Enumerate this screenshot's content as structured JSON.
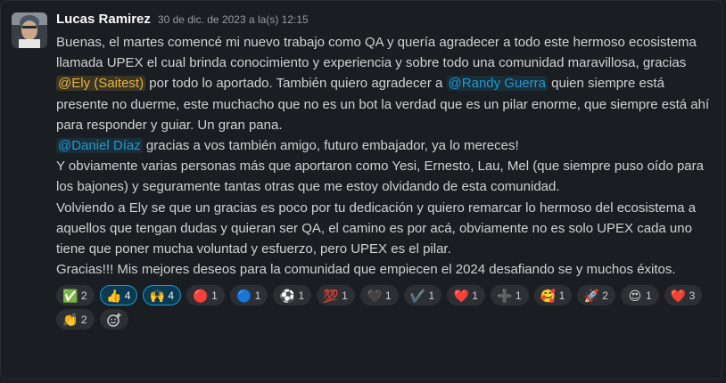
{
  "message": {
    "author": "Lucas Ramirez",
    "timestamp": "30 de dic. de 2023 a la(s) 12:15",
    "paragraphs": {
      "p1_a": "Buenas, el martes comencé mi nuevo trabajo como QA y quería agradecer a todo este hermoso ecosistema llamada UPEX el cual brinda conocimiento y experiencia y sobre todo una comunidad maravillosa, gracias ",
      "p1_mention1": "@Ely (Saitest)",
      "p1_b": " por todo lo aportado. También quiero agradecer a ",
      "p1_mention2": "@Randy Guerra",
      "p1_c": " quien siempre está presente no duerme, este muchacho que no es un bot la verdad que es un pilar enorme, que siempre está ahí para responder y guiar. Un gran pana.",
      "p2_mention": "@Daniel Díaz",
      "p2_text": " gracias a vos también amigo, futuro embajador, ya lo mereces!",
      "p3": "Y obviamente varias personas más que aportaron como Yesi, Ernesto, Lau, Mel (que siempre puso oído para los bajones) y seguramente tantas otras que me estoy olvidando de esta comunidad.",
      "p4": "Volviendo a Ely se que un gracias es poco por tu dedicación y quiero remarcar lo hermoso del ecosistema a aquellos que tengan dudas y quieran ser QA, el camino es por acá, obviamente no es solo UPEX cada uno tiene que poner mucha voluntad y esfuerzo, pero UPEX es el pilar.",
      "p5": "Gracias!!! Mis mejores deseos para la comunidad que empiecen el 2024 desafiando se y muchos éxitos."
    }
  },
  "reactions": [
    {
      "emoji": "✅",
      "icon": "white-check-mark-icon",
      "count": "2",
      "active": false
    },
    {
      "emoji": "👍",
      "icon": "thumbs-up-icon",
      "count": "4",
      "active": true
    },
    {
      "emoji": "🙌",
      "icon": "raised-hands-icon",
      "count": "4",
      "active": true
    },
    {
      "emoji": "🔴",
      "icon": "red-circle-icon",
      "count": "1",
      "active": false
    },
    {
      "emoji": "🔵",
      "icon": "blue-circle-icon",
      "count": "1",
      "active": false
    },
    {
      "emoji": "⚽",
      "icon": "soccer-ball-icon",
      "count": "1",
      "active": false
    },
    {
      "emoji": "💯",
      "icon": "hundred-points-icon",
      "count": "1",
      "active": false
    },
    {
      "emoji": "🖤",
      "icon": "black-heart-icon",
      "count": "1",
      "active": false
    },
    {
      "emoji": "✔️",
      "icon": "heavy-check-mark-icon",
      "count": "1",
      "active": false
    },
    {
      "emoji": "❤️",
      "icon": "red-heart-icon",
      "count": "1",
      "active": false
    },
    {
      "emoji": "➕",
      "icon": "plus-icon",
      "count": "1",
      "active": false
    },
    {
      "emoji": "🥰",
      "icon": "smiling-face-with-hearts-icon",
      "count": "1",
      "active": false
    },
    {
      "emoji": "🚀",
      "icon": "rocket-icon",
      "count": "2",
      "active": false
    },
    {
      "emoji": "😍",
      "icon": "heart-eyes-icon",
      "count": "1",
      "active": false
    },
    {
      "emoji": "❤️",
      "icon": "red-heart-icon",
      "count": "3",
      "active": false
    },
    {
      "emoji": "👏",
      "icon": "clapping-hands-icon",
      "count": "2",
      "active": false
    }
  ],
  "add_reaction_icon": "add-reaction-icon",
  "colors": {
    "background": "#1a1d21",
    "mention": "#1d9bd1",
    "mention_highlight": "#e8b63e",
    "reaction_active_border": "#1d9bd1"
  }
}
